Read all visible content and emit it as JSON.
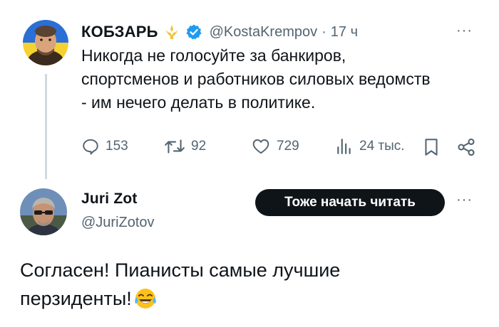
{
  "tweet1": {
    "display_name": "КОБЗАРЬ",
    "handle": "@KostaKrempov",
    "separator": "·",
    "time": "17 ч",
    "more": "···",
    "text_lines": [
      "Никогда не голосуйте за банкиров,",
      "спортсменов и работников силовых ведомств",
      "- им нечего делать в политике."
    ],
    "stats": {
      "replies": "153",
      "retweets": "92",
      "likes": "729",
      "views": "24 тыс."
    },
    "colors": {
      "verified": "#1d9bf0",
      "badge": "#f2c230"
    }
  },
  "tweet2": {
    "display_name": "Juri Zot",
    "handle": "@JuriZotov",
    "follow_label": "Тоже начать читать",
    "more": "···",
    "text_lines": [
      "Согласен! Пианисты самые лучшие",
      "перзиденты!"
    ],
    "emoji": "tears-of-joy-emoji"
  }
}
